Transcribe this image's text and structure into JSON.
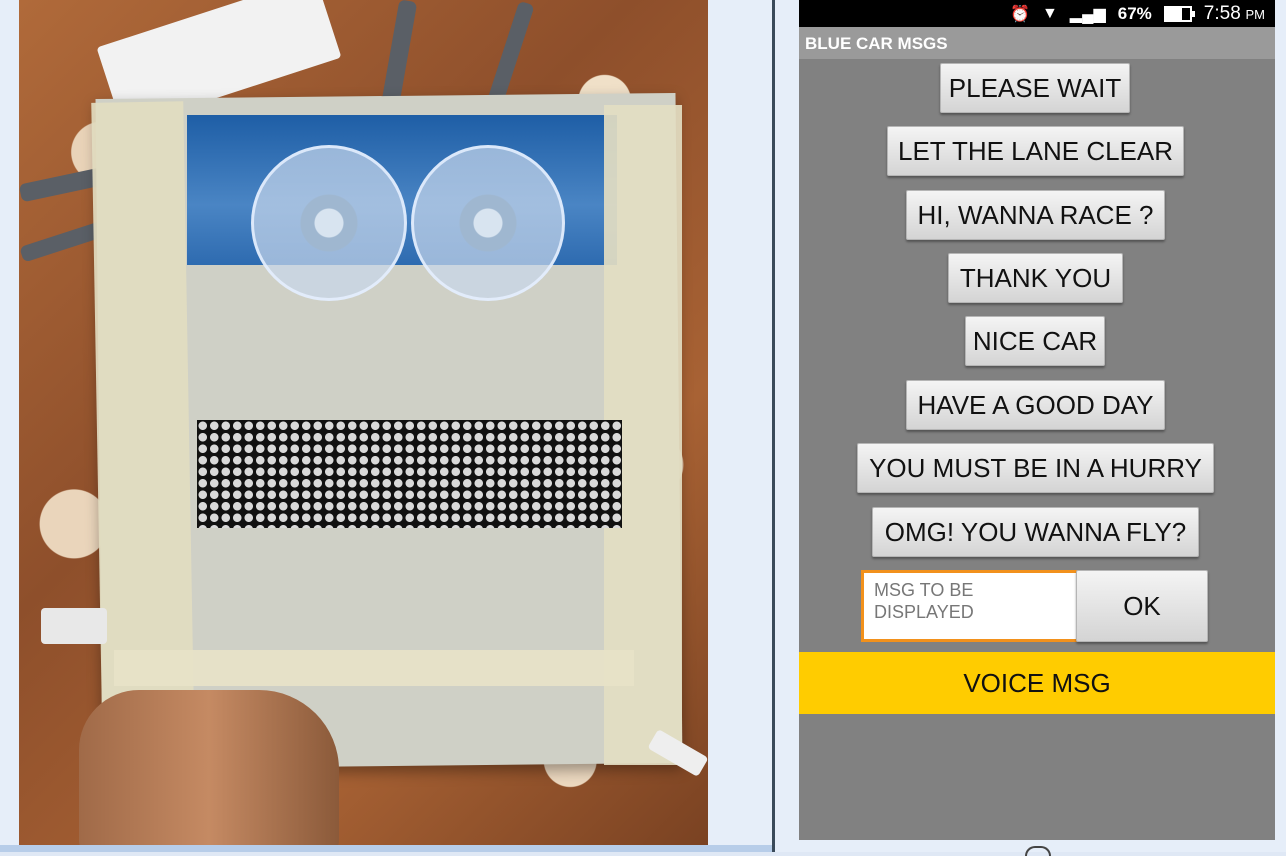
{
  "status_bar": {
    "battery_percent": "67%",
    "battery_level": 0.67,
    "time": "7:58",
    "ampm": "PM",
    "icons": [
      "alarm-icon",
      "wifi-icon",
      "signal-icon",
      "battery-icon"
    ]
  },
  "app": {
    "title": "BLUE CAR MSGS"
  },
  "buttons": [
    {
      "label": "PLEASE WAIT"
    },
    {
      "label": "LET THE LANE CLEAR"
    },
    {
      "label": "HI, WANNA RACE ?"
    },
    {
      "label": "THANK YOU"
    },
    {
      "label": "NICE CAR"
    },
    {
      "label": "HAVE A GOOD DAY"
    },
    {
      "label": "YOU MUST BE IN A HURRY"
    },
    {
      "label": "OMG! YOU WANNA FLY?"
    }
  ],
  "input": {
    "placeholder": "MSG TO BE DISPLAYED",
    "value": ""
  },
  "ok_label": "OK",
  "voice_label": "VOICE MSG",
  "colors": {
    "background": "#818181",
    "title_bar": "#9a9a9a",
    "input_border": "#f2911c",
    "voice_button": "#ffcc00"
  }
}
